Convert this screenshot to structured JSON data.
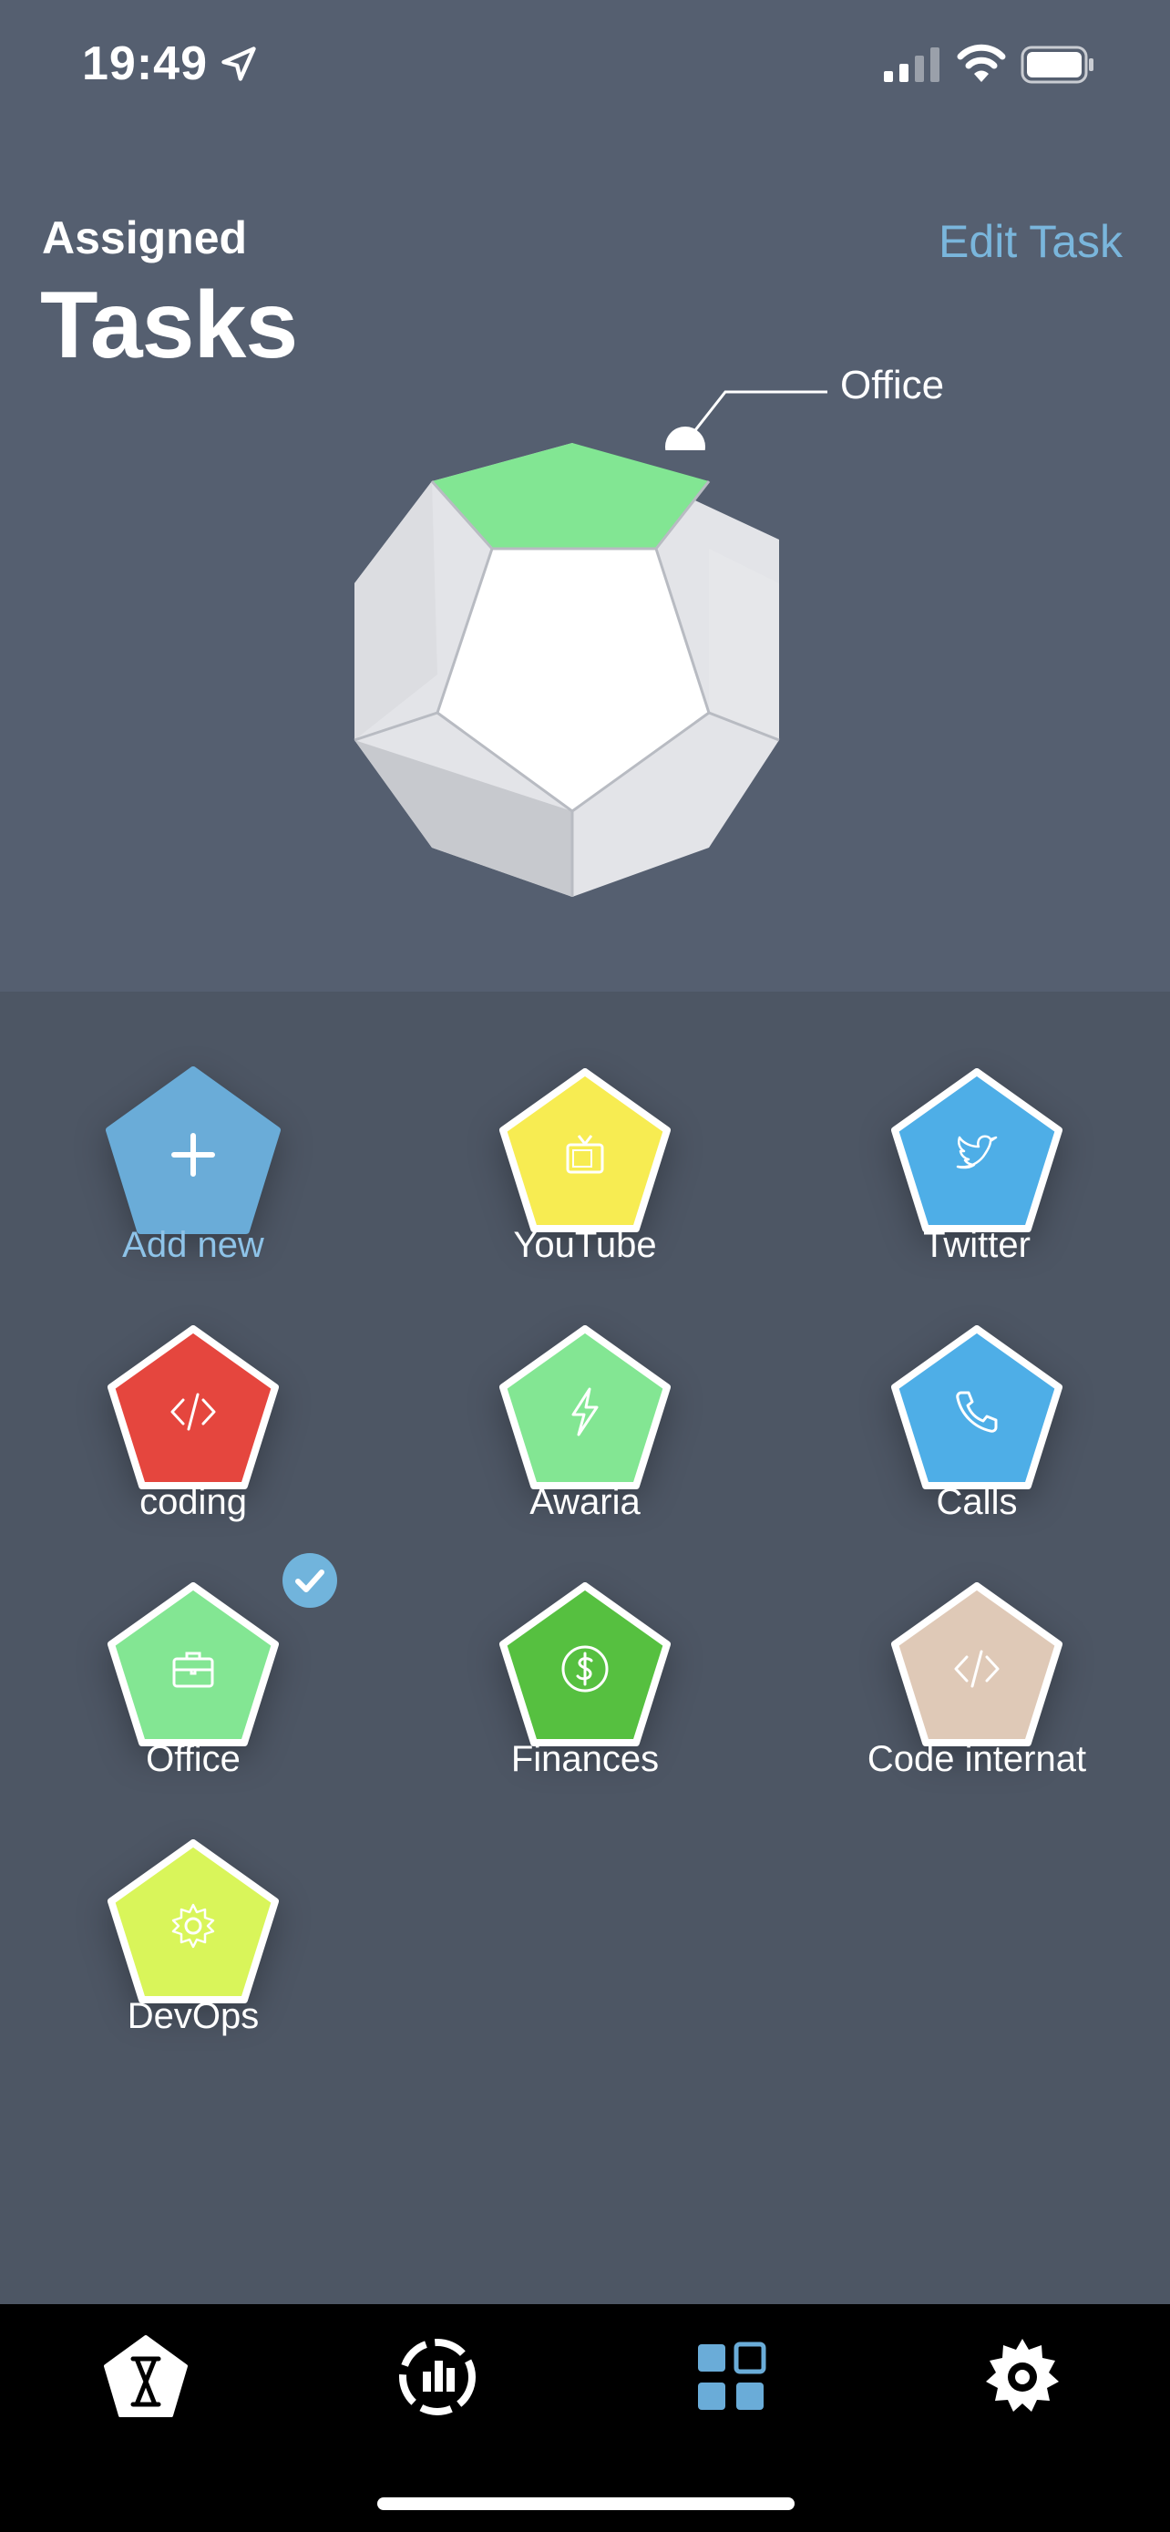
{
  "status": {
    "time": "19:49"
  },
  "header": {
    "kicker": "Assigned",
    "title": "Tasks",
    "edit_label": "Edit Task"
  },
  "callout": {
    "label": "Office"
  },
  "tasks": [
    {
      "name": "add-new",
      "label": "Add new",
      "color": "#6aacd8",
      "icon": "plus-icon"
    },
    {
      "name": "youtube",
      "label": "YouTube",
      "color": "#f7ec52",
      "icon": "tv-icon"
    },
    {
      "name": "twitter",
      "label": "Twitter",
      "color": "#4eaee7",
      "icon": "twitter-bird-icon"
    },
    {
      "name": "coding",
      "label": "coding",
      "color": "#e5463e",
      "icon": "code-icon"
    },
    {
      "name": "awaria",
      "label": "Awaria",
      "color": "#83e693",
      "icon": "lightning-icon"
    },
    {
      "name": "calls",
      "label": "Calls",
      "color": "#4eaee7",
      "icon": "phone-icon"
    },
    {
      "name": "office",
      "label": "Office",
      "color": "#83e693",
      "icon": "briefcase-icon",
      "selected": true
    },
    {
      "name": "finances",
      "label": "Finances",
      "color": "#56c040",
      "icon": "dollar-icon"
    },
    {
      "name": "code-internat",
      "label": "Code internat",
      "color": "#dfc9b7",
      "icon": "code-icon"
    },
    {
      "name": "devops",
      "label": "DevOps",
      "color": "#d9f55a",
      "icon": "gear-icon"
    }
  ],
  "tabbar": {
    "active_color": "#6aacd8",
    "items": [
      {
        "name": "timer-tab",
        "icon": "hourglass-icon"
      },
      {
        "name": "stats-tab",
        "icon": "chart-icon"
      },
      {
        "name": "tasks-tab",
        "icon": "grid-icon",
        "active": true
      },
      {
        "name": "settings-tab",
        "icon": "gear-icon"
      }
    ]
  }
}
